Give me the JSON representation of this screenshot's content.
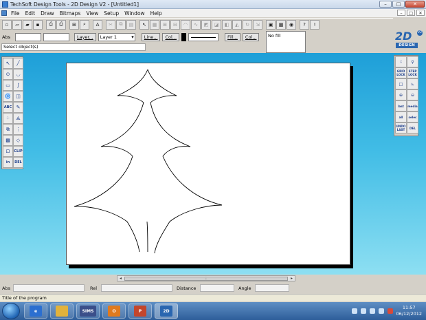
{
  "window": {
    "title": "TechSoft Design Tools - 2D Design V2 - [Untitled1]",
    "controls": {
      "minimize": "–",
      "maximize": "□",
      "close": "✕"
    }
  },
  "menu": {
    "items": [
      "File",
      "Edit",
      "Draw",
      "Bitmaps",
      "View",
      "Setup",
      "Window",
      "Help"
    ],
    "mdi_controls": [
      "–",
      "□",
      "✕"
    ]
  },
  "toolbar": {
    "buttons": [
      "new",
      "open",
      "open-folder",
      "save",
      "print-preview",
      "print",
      "zoom-select",
      "zoom",
      "text-style",
      "cut",
      "copy",
      "paste",
      "select-pointer",
      "layers",
      "grid",
      "snap",
      "arc",
      "bezier",
      "group",
      "ungroup",
      "fill",
      "mirror",
      "rotate",
      "stretch",
      "screen",
      "bitmap",
      "globe",
      "help-query",
      "tip"
    ]
  },
  "propbar": {
    "abs_label": "Abs",
    "layer_button": "Layer...",
    "layer_value": "Layer 1",
    "line_button": "Line...",
    "col_button_1": "Col...",
    "fill_button": "Fill...",
    "col_button_2": "Col...",
    "fill_value": "No fill",
    "line_color": "#000000"
  },
  "prompt": {
    "text": "Select object(s)"
  },
  "logo": {
    "big": "2D",
    "small": "DESIGN",
    "version": "V2",
    "color": "#2a66b0"
  },
  "left_tools": [
    {
      "name": "pointer-icon",
      "glyph": "↖"
    },
    {
      "name": "line-icon",
      "glyph": "╱"
    },
    {
      "name": "circle-icon",
      "glyph": "⊙"
    },
    {
      "name": "arc-icon",
      "glyph": "◡"
    },
    {
      "name": "rectangle-icon",
      "glyph": "▭"
    },
    {
      "name": "curve-icon",
      "glyph": "∫"
    },
    {
      "name": "spiral-icon",
      "glyph": "🌀"
    },
    {
      "name": "perspective-icon",
      "glyph": "◫"
    },
    {
      "name": "text-icon",
      "glyph": "ABC"
    },
    {
      "name": "edit-icon",
      "glyph": "✎"
    },
    {
      "name": "node-icon",
      "glyph": "⁘"
    },
    {
      "name": "construct-icon",
      "glyph": "⟁"
    },
    {
      "name": "group-icon",
      "glyph": "⧉"
    },
    {
      "name": "align-icon",
      "glyph": "⋮"
    },
    {
      "name": "fill-icon",
      "glyph": "▩"
    },
    {
      "name": "eraser-icon",
      "glyph": "◇"
    },
    {
      "name": "clip-icon",
      "glyph": "⊡"
    },
    {
      "name": "clip-button",
      "glyph": "CLIP"
    },
    {
      "name": "info-icon",
      "glyph": "in"
    },
    {
      "name": "delete-button",
      "glyph": "DEL"
    }
  ],
  "right_tools": [
    {
      "name": "grid-icon",
      "glyph": "⁙"
    },
    {
      "name": "snap-icon",
      "glyph": "⚲"
    },
    {
      "name": "grid-lock-button",
      "glyph": "GRID LOCK"
    },
    {
      "name": "step-lock-button",
      "glyph": "STEP LOCK"
    },
    {
      "name": "square-icon",
      "glyph": "□"
    },
    {
      "name": "axes-icon",
      "glyph": "⊾"
    },
    {
      "name": "zoom-in-icon",
      "glyph": "⊕"
    },
    {
      "name": "zoom-out-icon",
      "glyph": "⊖"
    },
    {
      "name": "last-view-button",
      "glyph": "last"
    },
    {
      "name": "media-button",
      "glyph": "media"
    },
    {
      "name": "all-button",
      "glyph": "all"
    },
    {
      "name": "select-button",
      "glyph": "selec"
    },
    {
      "name": "undo-last-button",
      "glyph": "UNDO LAST"
    },
    {
      "name": "delete-last-button",
      "glyph": "DEL"
    }
  ],
  "coords": {
    "abs": "Abs",
    "rel": "Rel",
    "distance": "Distance",
    "angle": "Angle"
  },
  "status": {
    "text": "Title of the program"
  },
  "taskbar": {
    "items": [
      {
        "name": "ie-icon",
        "label": "e",
        "color": "#2b6fd0"
      },
      {
        "name": "explorer-icon",
        "label": "",
        "color": "#e2b23c"
      },
      {
        "name": "sims-icon",
        "label": "SIMS",
        "color": "#3b4f8a"
      },
      {
        "name": "outlook-icon",
        "label": "O",
        "color": "#e07a1e"
      },
      {
        "name": "powerpoint-icon",
        "label": "P",
        "color": "#c3462c"
      },
      {
        "name": "2ddesign-icon",
        "label": "2D",
        "color": "#2a66b0"
      }
    ],
    "time": "11:57",
    "date": "06/12/2012"
  }
}
